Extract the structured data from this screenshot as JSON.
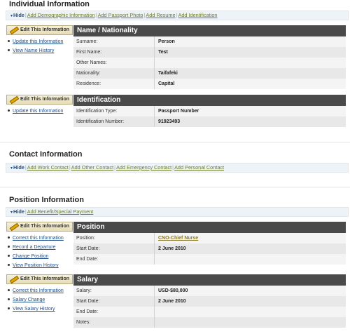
{
  "individual": {
    "title": "Individual Information",
    "actions": {
      "hide": "Hide",
      "links": [
        "Add Demographic Information",
        "Add Passport Photo",
        "Add Resume",
        "Add Identification"
      ]
    },
    "name_block": {
      "edit_label": "Edit This Information",
      "sidelinks": [
        "Update this Information",
        "View Name History"
      ],
      "heading": "Name / Nationality",
      "rows": [
        {
          "label": "Surname:",
          "value": "Person"
        },
        {
          "label": "First Name:",
          "value": "Test"
        },
        {
          "label": "Other Names:",
          "value": ""
        },
        {
          "label": "Nationality:",
          "value": "Taifafeki"
        },
        {
          "label": "Residence:",
          "value": "Capital"
        }
      ]
    },
    "id_block": {
      "edit_label": "Edit This Information",
      "sidelinks": [
        "Update this Information"
      ],
      "heading": "Identification",
      "rows": [
        {
          "label": "Identification Type:",
          "value": "Passport Number"
        },
        {
          "label": "Identification Number:",
          "value": "91923493"
        }
      ]
    }
  },
  "contact": {
    "title": "Contact Information",
    "actions": {
      "hide": "Hide",
      "links": [
        "Add Work Contact",
        "Add Other Contact",
        "Add Emergency Contact",
        "Add Personal Contact"
      ]
    }
  },
  "position": {
    "title": "Position Information",
    "actions": {
      "hide": "Hide",
      "links": [
        "Add Benefit/Special Payment"
      ]
    },
    "position_block": {
      "edit_label": "Edit This Information",
      "sidelinks": [
        "Correct this Information",
        "Record a Departure",
        "Change Position",
        "View Position History"
      ],
      "heading": "Position",
      "rows": [
        {
          "label": "Position:",
          "value": "CNO-Chief Nurse"
        },
        {
          "label": "Start Date:",
          "value": "2 June 2010"
        },
        {
          "label": "End Date:",
          "value": ""
        }
      ]
    },
    "salary_block": {
      "edit_label": "Edit This Information",
      "sidelinks": [
        "Correct this Information",
        "Salary Change",
        "View Salary History"
      ],
      "heading": "Salary",
      "rows": [
        {
          "label": "Salary:",
          "value": "USD-$80,000"
        },
        {
          "label": "Start Date:",
          "value": "2 June 2010"
        },
        {
          "label": "End Date:",
          "value": ""
        },
        {
          "label": "Notes:",
          "value": ""
        }
      ]
    }
  },
  "colors": {
    "panel_header": "#4a4a4a",
    "link_blue": "#1f4f8c",
    "link_olive": "#6b7b2a",
    "edit_button": "#e6dcb6"
  }
}
